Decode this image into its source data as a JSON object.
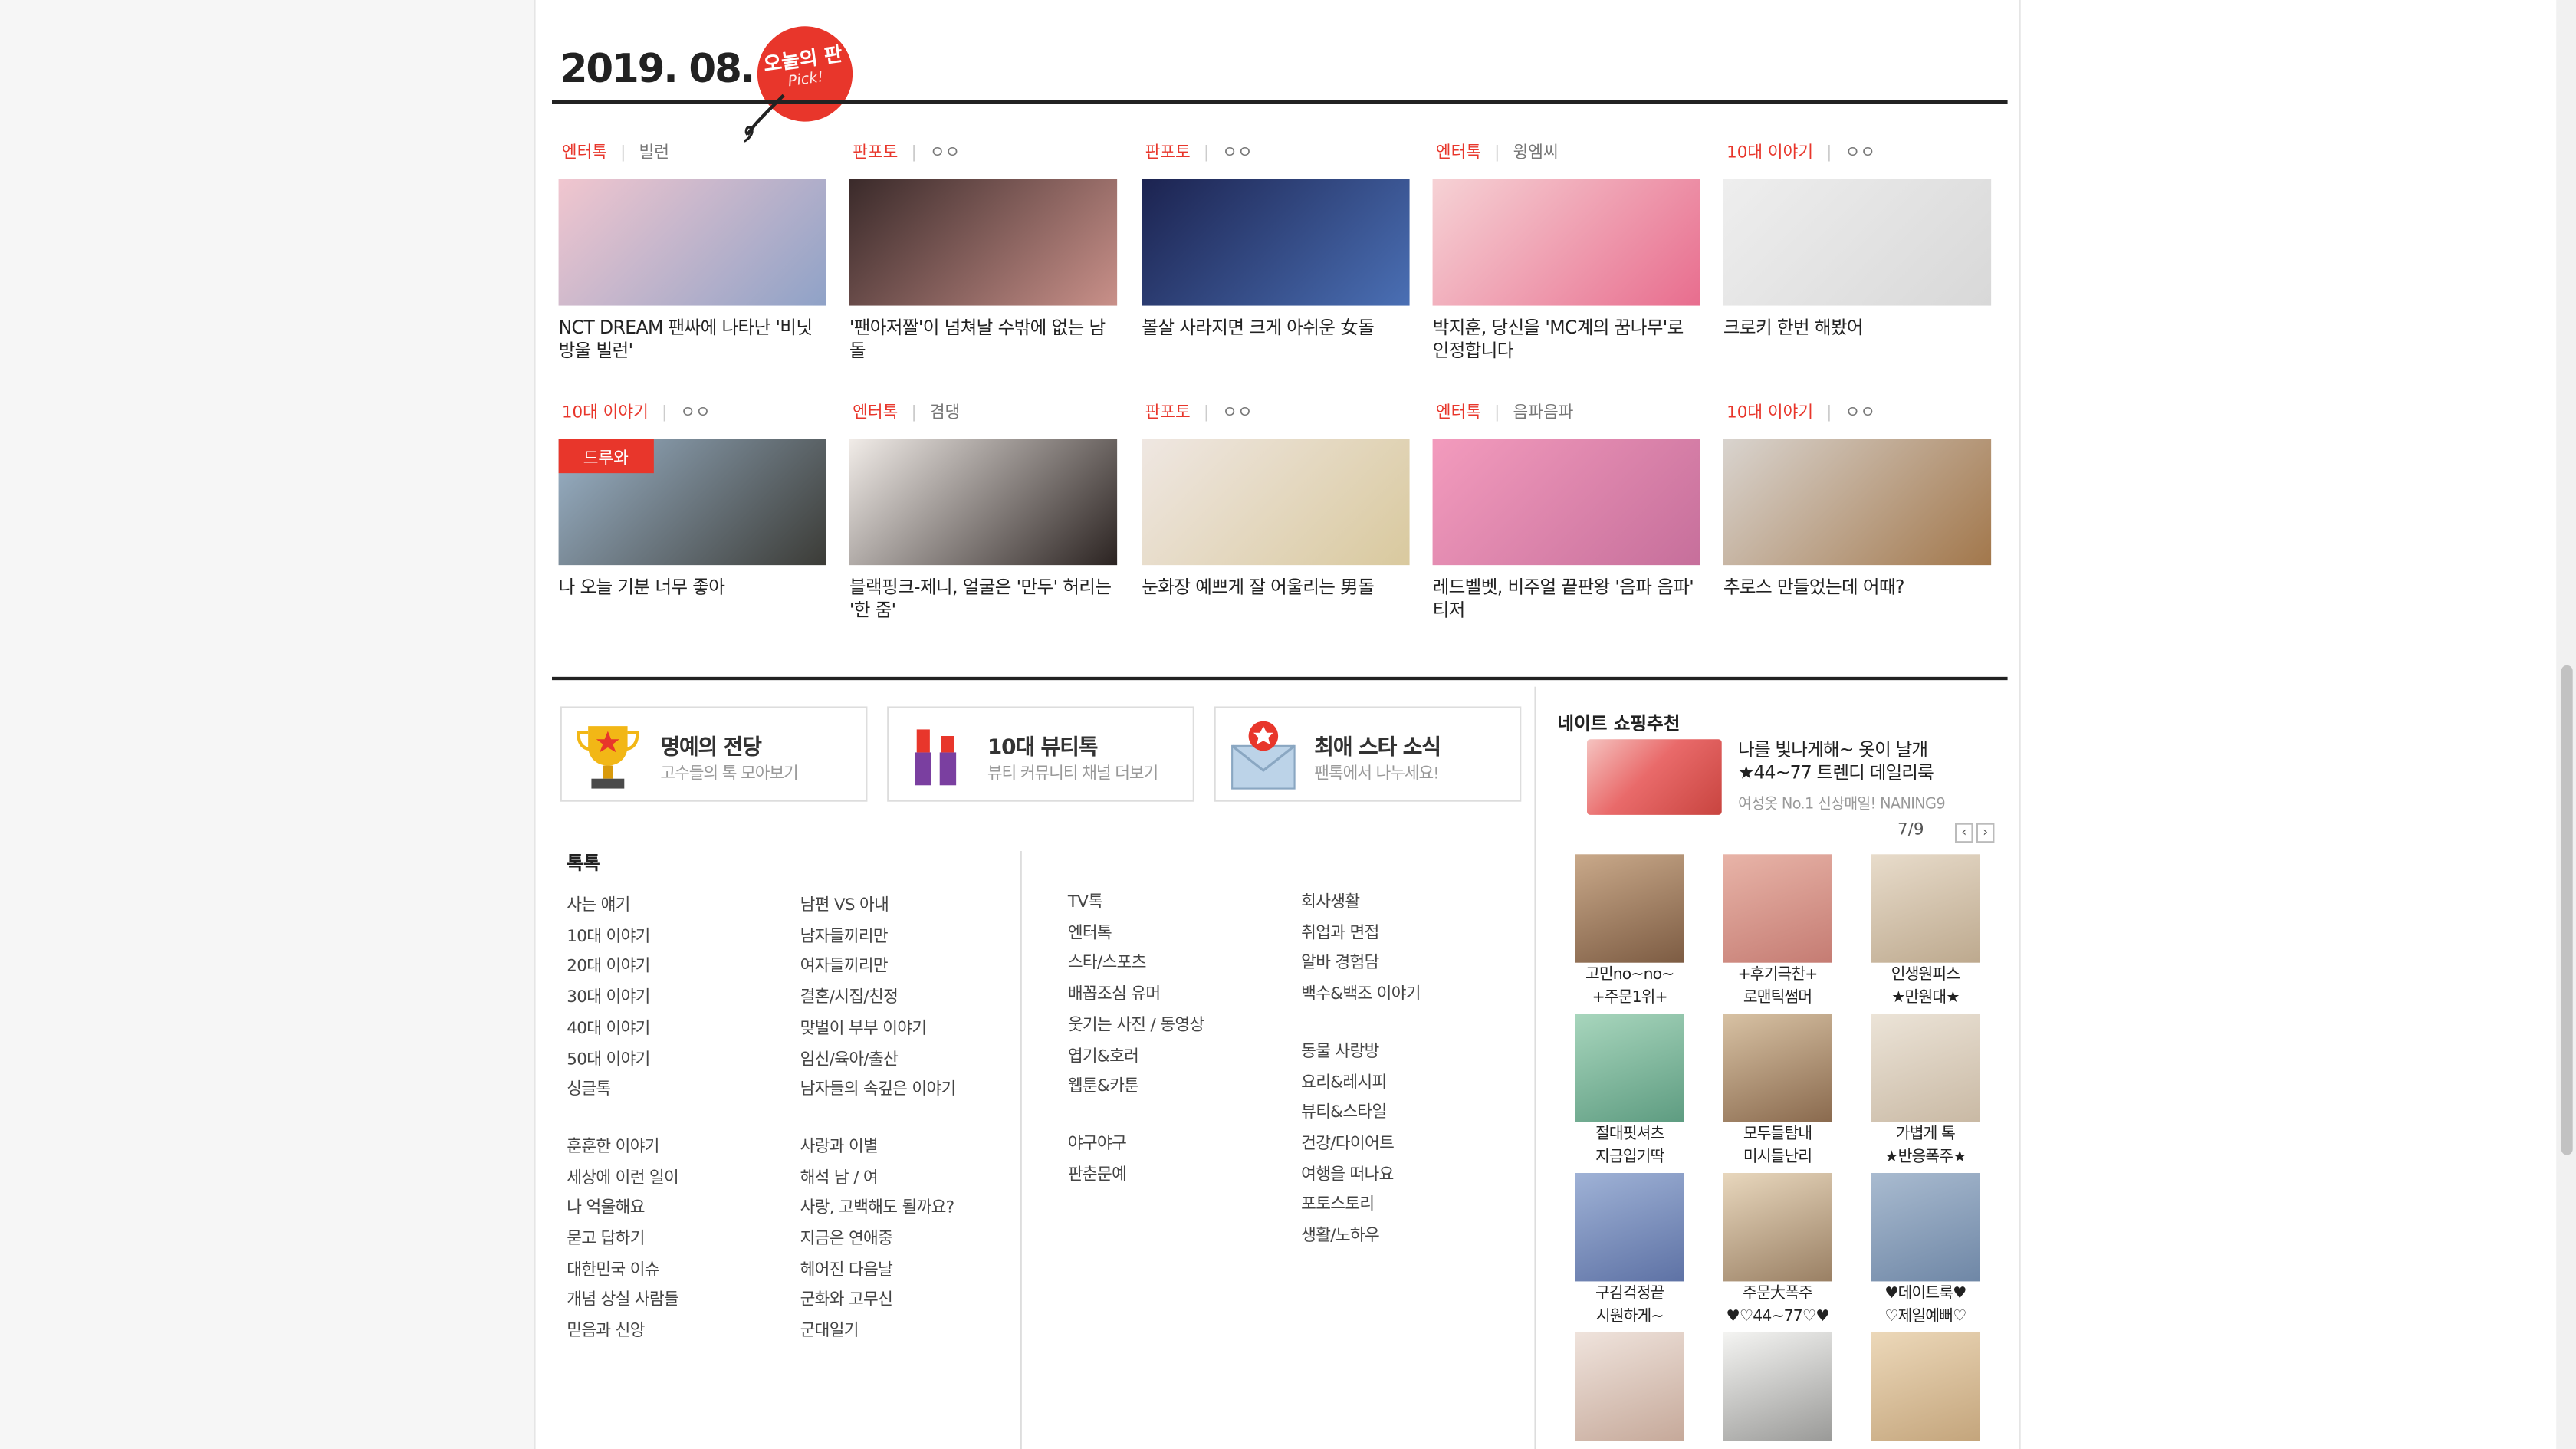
{
  "header": {
    "date": "2019. 08. 20",
    "badge_main": "오늘의 판",
    "badge_sub": "Pick!"
  },
  "articles_row1": [
    {
      "category": "엔터톡",
      "author": "빌런",
      "title": "NCT DREAM 팬싸에 나타난 '비닛 방울 빌런'",
      "thumb_colors": [
        "#f1c6cf",
        "#8fa2c7"
      ]
    },
    {
      "category": "판포토",
      "author": "ㅇㅇ",
      "title": "'팬아저짤'이 넘쳐날 수밖에 없는 남돌",
      "thumb_colors": [
        "#3a2a2a",
        "#c99089"
      ]
    },
    {
      "category": "판포토",
      "author": "ㅇㅇ",
      "title": "볼살 사라지면 크게 아쉬운 女돌",
      "thumb_colors": [
        "#1c2350",
        "#4a6fb4"
      ]
    },
    {
      "category": "엔터톡",
      "author": "윙엠씨",
      "title": "박지훈, 당신을 'MC계의 꿈나무'로 인정합니다",
      "thumb_colors": [
        "#f6d2d5",
        "#e86d8e"
      ]
    },
    {
      "category": "10대 이야기",
      "author": "ㅇㅇ",
      "title": "크로키 한번 해봤어",
      "thumb_colors": [
        "#eeeeee",
        "#d8d8d8"
      ]
    }
  ],
  "articles_row2": [
    {
      "category": "10대 이야기",
      "author": "ㅇㅇ",
      "title": "나 오늘 기분 너무 좋아",
      "tag": "드루와",
      "thumb_colors": [
        "#9bb3c9",
        "#3b3b36"
      ]
    },
    {
      "category": "엔터톡",
      "author": "겸댕",
      "title": "블랙핑크-제니, 얼굴은 '만두' 허리는 '한 줌'",
      "thumb_colors": [
        "#f1ece8",
        "#2b2321"
      ]
    },
    {
      "category": "판포토",
      "author": "ㅇㅇ",
      "title": "눈화장 예쁘게 잘 어울리는 男돌",
      "thumb_colors": [
        "#efe7e2",
        "#d9c99e"
      ]
    },
    {
      "category": "엔터톡",
      "author": "음파음파",
      "title": "레드벨벳, 비주얼 끝판왕 '음파 음파' 티저",
      "thumb_colors": [
        "#f39bbd",
        "#c66f9b"
      ]
    },
    {
      "category": "10대 이야기",
      "author": "ㅇㅇ",
      "title": "추로스 만들었는데 어때?",
      "thumb_colors": [
        "#d9d4cf",
        "#a2774b"
      ]
    }
  ],
  "banners": [
    {
      "title": "명예의 전당",
      "sub": "고수들의 톡 모아보기"
    },
    {
      "title": "10대 뷰티톡",
      "sub": "뷰티 커뮤니티 채널 더보기"
    },
    {
      "title": "최애 스타 소식",
      "sub": "팬톡에서 나누세요!"
    }
  ],
  "talk": {
    "heading": "톡톡",
    "col1a": [
      "사는 얘기",
      "10대 이야기",
      "20대 이야기",
      "30대 이야기",
      "40대 이야기",
      "50대 이야기",
      "싱글톡"
    ],
    "col1b": [
      "훈훈한 이야기",
      "세상에 이런 일이",
      "나 억울해요",
      "묻고 답하기",
      "대한민국 이슈",
      "개념 상실 사람들",
      "믿음과 신앙"
    ],
    "col2a": [
      "남편 VS 아내",
      "남자들끼리만",
      "여자들끼리만",
      "결혼/시집/친정",
      "맞벌이 부부 이야기",
      "임신/육아/출산",
      "남자들의 속깊은 이야기"
    ],
    "col2b": [
      "사랑과 이별",
      "해석 남 / 여",
      "사랑, 고백해도 될까요?",
      "지금은 연애중",
      "헤어진 다음날",
      "군화와 고무신",
      "군대일기"
    ],
    "col3a": [
      "TV톡",
      "엔터톡",
      "스타/스포츠",
      "배꼽조심 유머",
      "웃기는 사진 / 동영상",
      "엽기&호러",
      "웹툰&카툰"
    ],
    "col3b": [
      "야구야구",
      "판춘문예"
    ],
    "col4a": [
      "회사생활",
      "취업과 면접",
      "알바 경험담",
      "백수&백조 이야기"
    ],
    "col4b": [
      "동물 사랑방",
      "요리&레시피",
      "뷰티&스타일",
      "건강/다이어트",
      "여행을 떠나요",
      "포토스토리",
      "생활/노하우"
    ]
  },
  "shopping": {
    "title": "네이트 쇼핑추천",
    "ad_line1": "나를 빛나게해~ 옷이 날개",
    "ad_line2": "★44~77 트렌디 데일리룩",
    "ad_sub": "여성옷 No.1 신상매일! NANING9",
    "pager": "7/9",
    "prev": "‹",
    "next": "›",
    "products": [
      {
        "l1": "고민no~no~",
        "l2": "+주문1위+",
        "colors": [
          "#c9a98a",
          "#7d5c43"
        ]
      },
      {
        "l1": "+후기극찬+",
        "l2": "로맨틱썸머",
        "colors": [
          "#e8b4a8",
          "#c57c73"
        ]
      },
      {
        "l1": "인생원피스",
        "l2": "★만원대★",
        "colors": [
          "#e8dccb",
          "#bda98e"
        ]
      },
      {
        "l1": "절대핏셔츠",
        "l2": "지금입기딱",
        "colors": [
          "#a8d6bd",
          "#5e9c81"
        ]
      },
      {
        "l1": "모두들탐내",
        "l2": "미시들난리",
        "colors": [
          "#d8c2a4",
          "#8a6a4e"
        ]
      },
      {
        "l1": "가볍게 톡",
        "l2": "★반응폭주★",
        "colors": [
          "#ece4d8",
          "#c9b9a4"
        ]
      },
      {
        "l1": "구김걱정끝",
        "l2": "시원하게~",
        "colors": [
          "#9fb2d6",
          "#5e72a5"
        ]
      },
      {
        "l1": "주문大폭주",
        "l2": "♥♡44~77♡♥",
        "colors": [
          "#e8d7bd",
          "#9a8064"
        ]
      },
      {
        "l1": "♥데이트룩♥",
        "l2": "♡제일예뻐♡",
        "colors": [
          "#a9bbd0",
          "#6f87a6"
        ]
      },
      {
        "l1": "",
        "l2": "",
        "colors": [
          "#efe3dc",
          "#c6a99a"
        ]
      },
      {
        "l1": "",
        "l2": "",
        "colors": [
          "#f4f4f2",
          "#9a9a98"
        ]
      },
      {
        "l1": "",
        "l2": "",
        "colors": [
          "#ecd8b9",
          "#c4a57c"
        ]
      }
    ]
  },
  "colors": {
    "accent": "#e8362b"
  }
}
